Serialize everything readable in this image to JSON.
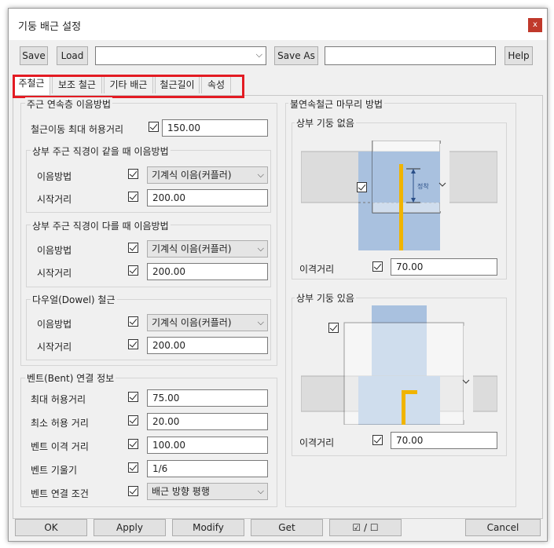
{
  "window": {
    "title": "기둥 배근 설정",
    "close_label": "x"
  },
  "toolbar": {
    "save": "Save",
    "load": "Load",
    "save_as": "Save As",
    "help": "Help",
    "preset_value": "",
    "save_as_value": ""
  },
  "tabs": [
    "주철근",
    "보조 철근",
    "기타 배근",
    "철근길이",
    "속성"
  ],
  "main_group": {
    "title": "주근 연속층 이음방법",
    "max_dist_label": "철근이동 최대 허용거리",
    "max_dist_value": "150.00",
    "same_dia": {
      "title": "상부 주근 직경이 같을 때 이음방법",
      "method_label": "이음방법",
      "method_value": "기계식 이음(커플러)",
      "start_label": "시작거리",
      "start_value": "200.00"
    },
    "diff_dia": {
      "title": "상부 주근 직경이 다를 때 이음방법",
      "method_label": "이음방법",
      "method_value": "기계식 이음(커플러)",
      "start_label": "시작거리",
      "start_value": "200.00"
    },
    "dowel": {
      "title": "다우얼(Dowel) 철근",
      "method_label": "이음방법",
      "method_value": "기계식 이음(커플러)",
      "start_label": "시작거리",
      "start_value": "200.00"
    }
  },
  "bent_group": {
    "title": "벤트(Bent) 연결 정보",
    "rows": [
      {
        "label": "최대 허용거리",
        "value": "75.00"
      },
      {
        "label": "최소 허용 거리",
        "value": "20.00"
      },
      {
        "label": "벤트 이격 거리",
        "value": "100.00"
      },
      {
        "label": "벤트 기울기",
        "value": "1/6"
      }
    ],
    "cond_label": "벤트 연결 조건",
    "cond_value": "배근 방향 평행"
  },
  "right_group": {
    "title": "불연속철근 마무리 방법",
    "no_upper": {
      "title": "상부 기둥 없음",
      "dim_text": "정착",
      "dist_label": "이격거리",
      "dist_value": "70.00"
    },
    "with_upper": {
      "title": "상부 기둥 있음",
      "dist_label": "이격거리",
      "dist_value": "70.00"
    }
  },
  "footer": {
    "ok": "OK",
    "apply": "Apply",
    "modify": "Modify",
    "get": "Get",
    "check_toggle": "☑ / ☐",
    "cancel": "Cancel"
  },
  "colors": {
    "column_fill": "#a9c1df",
    "beam_fill": "#dcdcdc",
    "rebar": "#f0b400",
    "highlight": "#e31b23"
  }
}
